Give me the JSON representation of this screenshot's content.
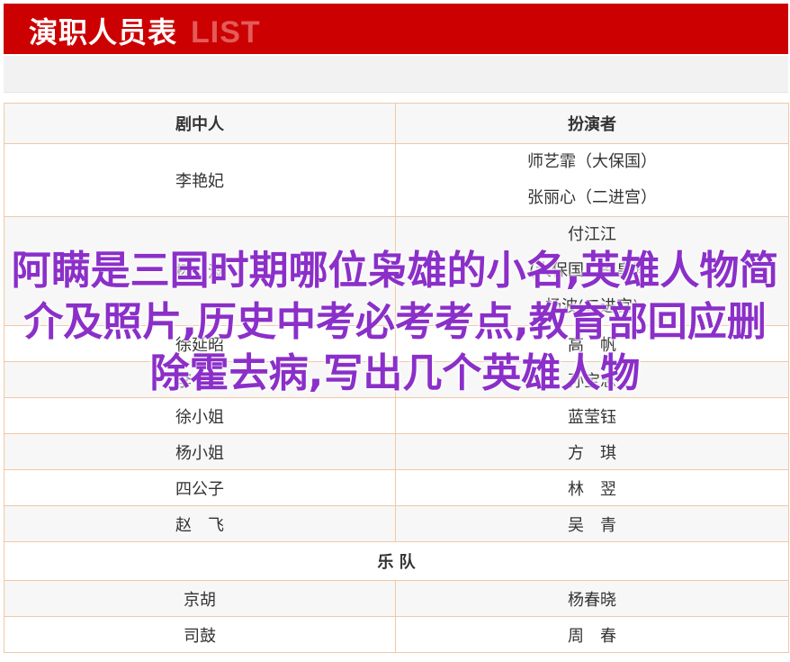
{
  "header": {
    "title": "演职人员表",
    "subtitle": "LIST",
    "bar_color": "#cc0000"
  },
  "table": {
    "headers": [
      "剧中人",
      "扮演者"
    ],
    "rows": [
      {
        "role": "李艳妃",
        "actors": [
          "师艺霏（大保国）",
          "张丽心（二进宫）"
        ]
      },
      {
        "role": "杨　波",
        "actors": [
          "付江江",
          "(大保国、探皇陵)",
          "杨波(二进宫)"
        ]
      },
      {
        "role": "徐延昭",
        "actors": [
          "高　帆"
        ]
      },
      {
        "role": "李　良",
        "actors": [
          "孙宝忠"
        ]
      },
      {
        "role": "徐小姐",
        "actors": [
          "蓝莹钰"
        ]
      },
      {
        "role": "杨小姐",
        "actors": [
          "方　琪"
        ]
      },
      {
        "role": "四公子",
        "actors": [
          "林　翌"
        ]
      },
      {
        "role": "赵　飞",
        "actors": [
          "吴　青"
        ]
      }
    ],
    "section_label": "乐 队",
    "band_rows": [
      {
        "role": "京胡",
        "actors": [
          "杨春晓"
        ]
      },
      {
        "role": "司鼓",
        "actors": [
          "周　春"
        ]
      }
    ]
  },
  "overlay_text": "阿瞒是三国时期哪位枭雄的小名,英雄人物简介及照片,历史中考必考考点,教育部回应删除霍去病,写出几个英雄人物",
  "colors": {
    "overlay": "#8b2fc9",
    "border": "#f0c8a8"
  }
}
